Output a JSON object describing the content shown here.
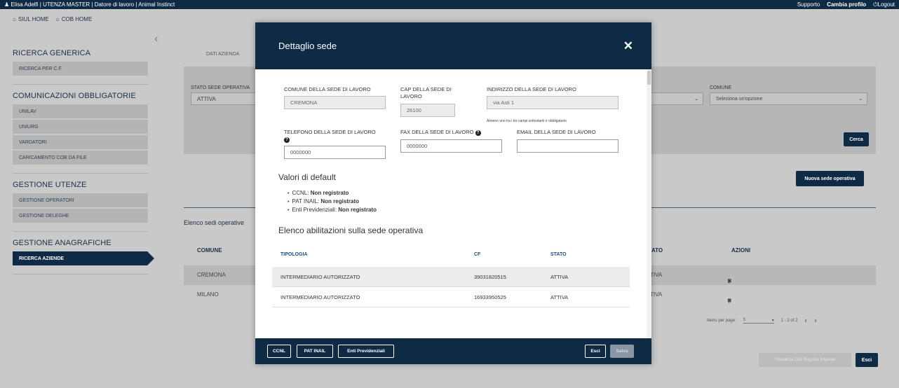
{
  "topbar": {
    "user_info": "Elisa Adelfi | UTENZA MASTER | Datore di lavoro | Animal Instinct",
    "support": "Supporto",
    "change_profile": "Cambia profilo",
    "logout": "Logout"
  },
  "homenav": {
    "siul_home": "SIUL HOME",
    "cob_home": "COB HOME"
  },
  "sidebar": {
    "sections": [
      {
        "title": "RICERCA GENERICA",
        "items": [
          "RICERCA PER C.F."
        ]
      },
      {
        "title": "COMUNICAZIONI OBBLIGATORIE",
        "items": [
          "UNILAV",
          "UNIURG",
          "VARDATORI",
          "CARICAMENTO COB DA FILE"
        ]
      },
      {
        "title": "GESTIONE UTENZE",
        "items": [
          "GESTIONE OPERATORI",
          "GESTIONE DELEGHE"
        ]
      },
      {
        "title": "GESTIONE ANAGRAFICHE",
        "items": [
          "RICERCA AZIENDE"
        ]
      }
    ],
    "active_item": "RICERCA AZIENDE"
  },
  "background": {
    "tab_label": "DATI AZIENDA",
    "stato_label": "STATO SEDE OPERATIVA",
    "stato_value": "ATTIVA",
    "comune_label": "COMUNE",
    "comune_placeholder": "Seleziona un'opzione",
    "cerca_button": "Cerca",
    "nuova_sede_button": "Nuova sede operativa",
    "elenco_title": "Elenco sedi operative",
    "columns": {
      "comune": "COMUNE",
      "stato": "ATO",
      "azioni": "AZIONI"
    },
    "rows": [
      {
        "comune": "CREMONA",
        "stato": "TIVA"
      },
      {
        "comune": "MILANO",
        "stato": "TIVA"
      }
    ],
    "pager": {
      "items_label": "Items per page:",
      "items_value": "5",
      "range": "1 - 2 of 2"
    },
    "visualizza_button": "Visualizza Dati Registro Imprese",
    "esci_button": "Esci"
  },
  "modal": {
    "title": "Dettaglio sede",
    "comune_label": "COMUNE DELLA SEDE DI LAVORO",
    "comune_value": "CREMONA",
    "cap_label_1": "CAP DELLA SEDE DI",
    "cap_label_2": "LAVORO",
    "cap_value": "26100",
    "indirizzo_label": "INDIRIZZO DELLA SEDE DI LAVORO",
    "indirizzo_value": "via Asti 1",
    "note": "Almeno uno tra i tre campi sottostanti è obbligatorio",
    "telefono_label": "TELEFONO DELLA SEDE DI LAVORO",
    "telefono_value": "0000000",
    "fax_label": "FAX DELLA SEDE DI LAVORO",
    "fax_value": "0000000",
    "email_label": "EMAIL DELLA SEDE DI LAVORO",
    "email_value": "",
    "defaults_title": "Valori di default",
    "defaults": [
      {
        "name": "CCNL:",
        "value": "Non registrato"
      },
      {
        "name": "PAT INAIL:",
        "value": "Non registrato"
      },
      {
        "name": "Enti Previdenziali:",
        "value": "Non registrato"
      }
    ],
    "abilitazioni_title": "Elenco abilitazioni sulla sede operativa",
    "table_headers": {
      "tipologia": "TIPOLOGIA",
      "cf": "CF",
      "stato": "STATO"
    },
    "table_rows": [
      {
        "tipologia": "INTERMEDIARIO AUTORIZZATO",
        "cf": "39031820515",
        "stato": "ATTIVA"
      },
      {
        "tipologia": "INTERMEDIARIO AUTORIZZATO",
        "cf": "16933950525",
        "stato": "ATTIVA"
      }
    ],
    "footer": {
      "ccnl": "CCNL",
      "pat_inail": "PAT INAIL",
      "enti": "Enti Previdenziali",
      "esci": "Esci",
      "salva": "Salva"
    }
  },
  "colors": {
    "navy": "#0e2a45",
    "overlay_grey": "#c9c9c9",
    "link_blue": "#1d4f7a"
  }
}
